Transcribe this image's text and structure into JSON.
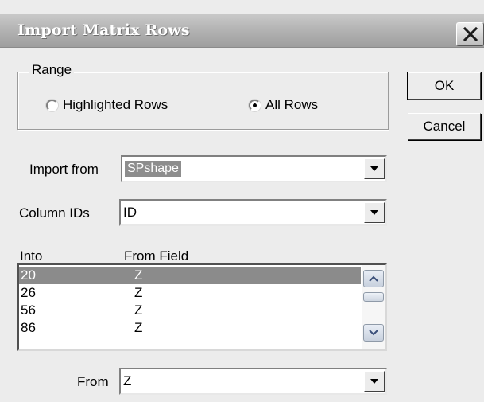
{
  "window": {
    "title": "Import Matrix Rows"
  },
  "range": {
    "legend": "Range",
    "options": [
      {
        "label": "Highlighted Rows",
        "checked": false
      },
      {
        "label": "All Rows",
        "checked": true
      }
    ]
  },
  "buttons": {
    "ok": "OK",
    "cancel": "Cancel"
  },
  "import_from": {
    "label": "Import from",
    "value": "SPshape"
  },
  "column_ids": {
    "label": "Column IDs",
    "value": "ID"
  },
  "list": {
    "headers": {
      "into": "Into",
      "from_field": "From Field"
    },
    "rows": [
      {
        "into": "20",
        "from": "Z",
        "selected": true
      },
      {
        "into": "26",
        "from": "Z",
        "selected": false
      },
      {
        "into": "56",
        "from": "Z",
        "selected": false
      },
      {
        "into": "86",
        "from": "Z",
        "selected": false
      }
    ]
  },
  "from": {
    "label": "From",
    "value": "Z"
  },
  "icons": {
    "close": "close-icon",
    "dropdown": "chevron-down-icon",
    "scroll_up": "scroll-up-icon",
    "scroll_down": "scroll-down-icon"
  }
}
